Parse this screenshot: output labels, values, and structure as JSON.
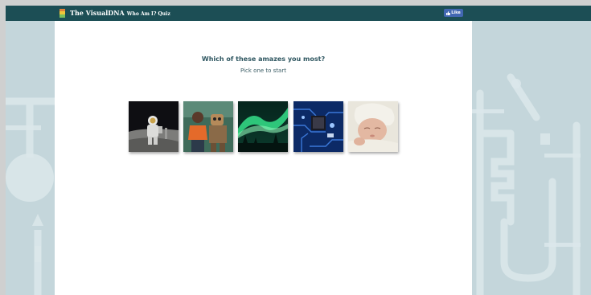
{
  "header": {
    "brand": "The VisualDNA",
    "product": "Who Am I? Quiz",
    "like_label": "Like",
    "logo_icon": "beaker-icon",
    "bar_color": "#1c4e55"
  },
  "quiz": {
    "question": "Which of these amazes you most?",
    "instruction": "Pick one to start",
    "choices": [
      {
        "icon": "astronaut-moon-image"
      },
      {
        "icon": "robot-costume-people-image"
      },
      {
        "icon": "aurora-borealis-image"
      },
      {
        "icon": "circuit-board-image"
      },
      {
        "icon": "newborn-baby-image"
      }
    ]
  },
  "theme": {
    "side_background": "#c4d6db",
    "panel_background": "#ffffff",
    "like_button_color": "#4267b2"
  }
}
